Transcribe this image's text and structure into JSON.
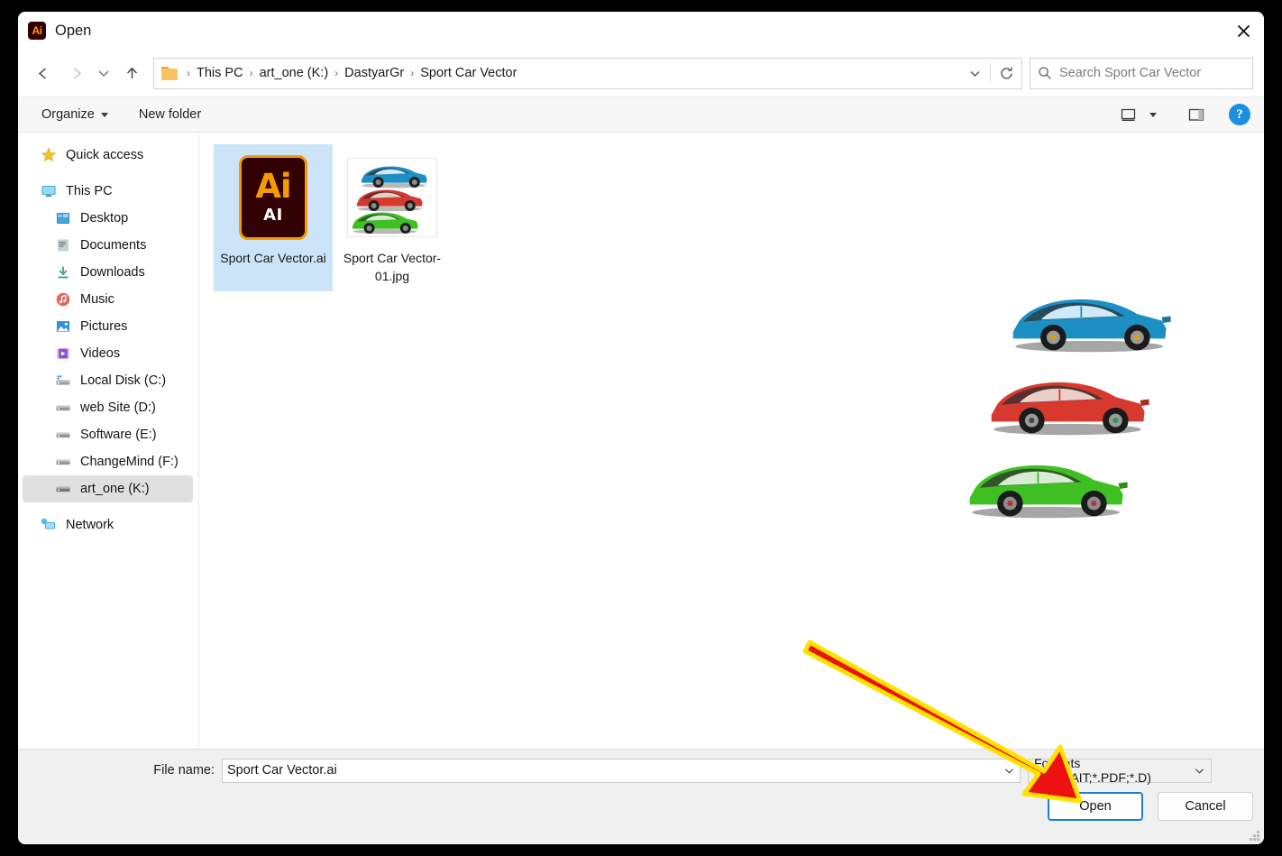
{
  "window": {
    "title": "Open",
    "app_icon": "ai-app-icon",
    "app_icon_text": "Ai",
    "close_icon": "close-icon"
  },
  "navbar": {
    "back_icon": "arrow-left-icon",
    "forward_icon": "arrow-right-icon",
    "recent_icon": "chevron-down-icon",
    "up_icon": "arrow-up-icon",
    "breadcrumb": [
      "This PC",
      "art_one (K:)",
      "DastyarGr",
      "Sport Car Vector"
    ],
    "breadcrumb_separator": "›",
    "dropdown_icon": "chevron-down-icon",
    "refresh_icon": "refresh-icon",
    "search": {
      "icon": "search-icon",
      "placeholder": "Search Sport Car Vector",
      "value": ""
    }
  },
  "commandbar": {
    "organize_label": "Organize",
    "new_folder_label": "New folder",
    "view_icon": "view-layout-icon",
    "view_caret_icon": "chevron-down-icon",
    "pane_icon": "preview-pane-icon",
    "help_icon": "help-icon",
    "help_glyph": "?"
  },
  "sidebar": {
    "items": [
      {
        "label": "Quick access",
        "icon": "star-icon",
        "level": 1,
        "selected": false
      },
      {
        "label": "This PC",
        "icon": "monitor-icon",
        "level": 1,
        "selected": false
      },
      {
        "label": "Desktop",
        "icon": "desktop-folder-icon",
        "level": 2,
        "selected": false
      },
      {
        "label": "Documents",
        "icon": "documents-icon",
        "level": 2,
        "selected": false
      },
      {
        "label": "Downloads",
        "icon": "downloads-icon",
        "level": 2,
        "selected": false
      },
      {
        "label": "Music",
        "icon": "music-icon",
        "level": 2,
        "selected": false
      },
      {
        "label": "Pictures",
        "icon": "pictures-icon",
        "level": 2,
        "selected": false
      },
      {
        "label": "Videos",
        "icon": "videos-icon",
        "level": 2,
        "selected": false
      },
      {
        "label": "Local Disk (C:)",
        "icon": "drive-icon",
        "level": 2,
        "selected": false
      },
      {
        "label": "web Site (D:)",
        "icon": "drive-icon",
        "level": 2,
        "selected": false
      },
      {
        "label": "Software (E:)",
        "icon": "drive-icon",
        "level": 2,
        "selected": false
      },
      {
        "label": "ChangeMind (F:)",
        "icon": "drive-icon",
        "level": 2,
        "selected": false
      },
      {
        "label": "art_one (K:)",
        "icon": "drive-icon",
        "level": 2,
        "selected": true
      },
      {
        "label": "Network",
        "icon": "network-icon",
        "level": 1,
        "selected": false
      }
    ]
  },
  "files": [
    {
      "name": "Sport Car Vector.ai",
      "thumb": "ai-document-icon",
      "badge_big": "Ai",
      "badge_small": "AI",
      "selected": true
    },
    {
      "name": "Sport Car Vector-01.jpg",
      "thumb": "car-image-thumbnail",
      "selected": false
    }
  ],
  "preview": {
    "name": "preview-cars",
    "cars": [
      {
        "color": "#1c8fc4",
        "label": "blue-sports-car"
      },
      {
        "color": "#d8392f",
        "label": "red-sports-car"
      },
      {
        "color": "#3fc022",
        "label": "green-sports-car"
      }
    ]
  },
  "footer": {
    "filename_label": "File name:",
    "filename_value": "Sport Car Vector.ai",
    "filename_caret_icon": "chevron-down-icon",
    "format_value": "Formats (*.AI;*.AIT;*.PDF;*.D)",
    "format_caret_icon": "chevron-down-icon",
    "open_label": "Open",
    "cancel_label": "Cancel",
    "resize_grip_icon": "resize-grip-icon"
  },
  "annotation": {
    "arrow_name": "red-callout-arrow",
    "fill": "#ee1111",
    "stroke": "#ffe200",
    "points_to": "open-button"
  },
  "colors": {
    "selection_blue": "#cce4f7",
    "accent_blue": "#1a7fd4",
    "sidebar_selected": "#e0e0e0",
    "ai_orange": "#f59b00",
    "ai_dark": "#310000"
  }
}
